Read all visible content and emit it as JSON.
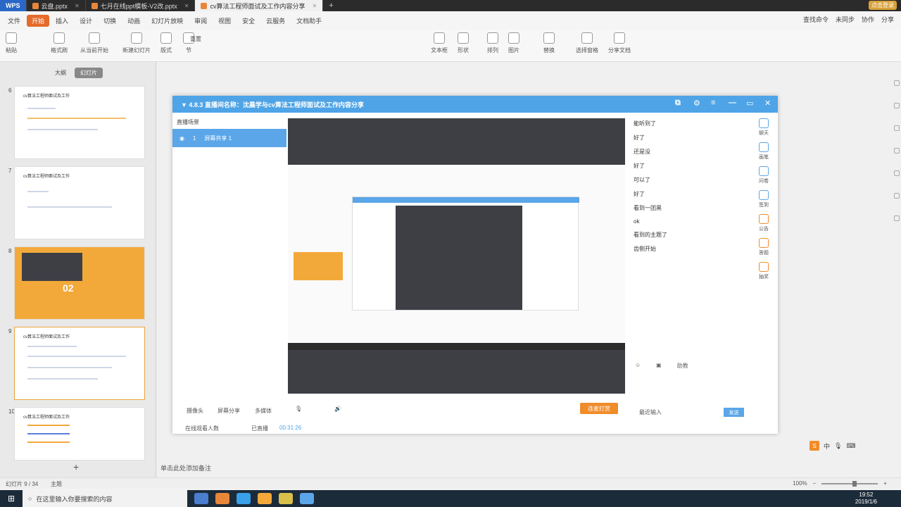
{
  "tabs": [
    {
      "label": "WPS",
      "kind": "logo"
    },
    {
      "label": "云盘.pptx"
    },
    {
      "label": "七月在线ppt模板-V2改.pptx"
    },
    {
      "label": "cv算法工程师面试及工作内容分享",
      "active": true
    }
  ],
  "user_badge": "点击登录",
  "menus": [
    "文件",
    "开始",
    "插入",
    "设计",
    "切换",
    "动画",
    "幻灯片放映",
    "审阅",
    "视图",
    "安全",
    "云服务",
    "文档助手"
  ],
  "menu_right": [
    "查找命令",
    "未同步",
    "协作",
    "分享"
  ],
  "toolbar": [
    {
      "label": "粘贴"
    },
    {
      "label": "格式刷"
    },
    {
      "label": "从当前开始"
    },
    {
      "label": "新建幻灯片"
    },
    {
      "label": "版式"
    },
    {
      "label": "节"
    },
    {
      "label": "重置"
    },
    {
      "label": "文本框"
    },
    {
      "label": "形状"
    },
    {
      "label": "排列"
    },
    {
      "label": "图片"
    },
    {
      "label": "替换"
    },
    {
      "label": "选择窗格"
    },
    {
      "label": "分享文档"
    }
  ],
  "panel_tabs": [
    "大纲",
    "幻灯片"
  ],
  "slides": [
    {
      "num": "6",
      "title": "cv算法工程师面试及工作"
    },
    {
      "num": "7",
      "title": "cv算法工程师面试及工作"
    },
    {
      "num": "8",
      "title": "02"
    },
    {
      "num": "9",
      "title": "cv算法工程师面试及工作"
    },
    {
      "num": "10",
      "title": "cv算法工程师面试及工作"
    }
  ],
  "live": {
    "title": "▼ 4.8.3  直播间名称：沈晨学与cv算法工程师面试及工作内容分享",
    "sidebar_header": "直播场景",
    "sidebar_item_num": "1",
    "sidebar_item": "屏幕共享 1",
    "controls": {
      "camera": "摄像头",
      "screen": "屏幕分享",
      "multi": "多媒体",
      "gift": "连麦打赏",
      "viewers": "在线观看人数",
      "duration_label": "已直播",
      "duration": "00:31:26"
    },
    "chat": [
      {
        "who": "",
        "text": "能听到了"
      },
      {
        "who": "",
        "text": "好了"
      },
      {
        "who": "",
        "text": "还是没"
      },
      {
        "who": "",
        "text": "好了"
      },
      {
        "who": "",
        "text": "可以了"
      },
      {
        "who": "",
        "text": "好了"
      },
      {
        "who": "",
        "text": "看到一团黑"
      },
      {
        "who": "",
        "text": "ok"
      },
      {
        "who": "",
        "text": "看到的主题了"
      },
      {
        "who": "",
        "text": "齿侧开始"
      }
    ],
    "chat_input": "助教",
    "send_label": "发送",
    "reply_placeholder": "最近输入",
    "right_tools": [
      "聊天",
      "画笔",
      "问卷",
      "签到",
      "公告",
      "答题",
      "抽奖"
    ]
  },
  "notes_placeholder": "单击此处添加备注",
  "status": {
    "slide_info": "幻灯片 9 / 34",
    "theme": "主题",
    "zoom": "100%"
  },
  "taskbar": {
    "search_placeholder": "在这里输入你要搜索的内容",
    "time": "19:52",
    "date": "2019/1/6"
  }
}
